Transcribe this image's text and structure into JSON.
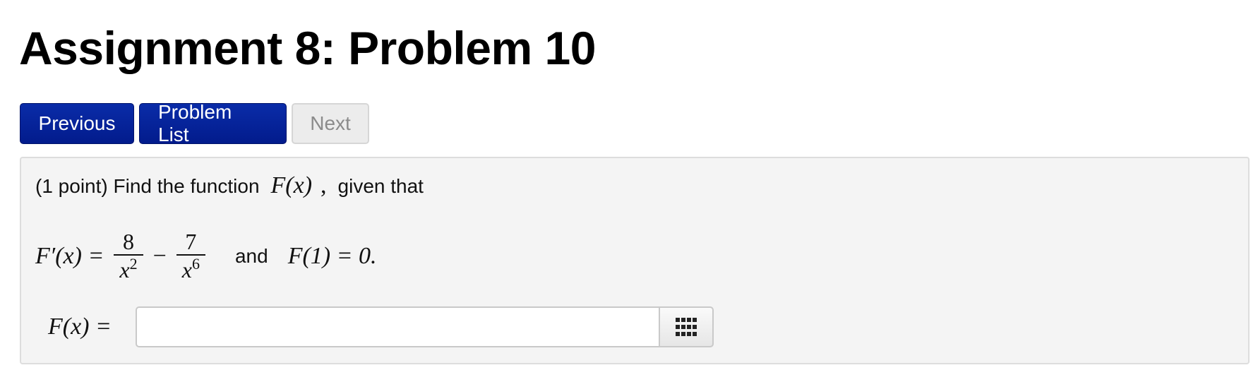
{
  "page": {
    "title": "Assignment 8: Problem 10"
  },
  "nav": {
    "previous_label": "Previous",
    "problem_list_label": "Problem List",
    "next_label": "Next"
  },
  "problem": {
    "points_text": "(1 point) Find the function",
    "function_name": "F(x)",
    "comma": ",",
    "given_text": "given that",
    "derivative_lhs": "F′(x) =",
    "term1_numerator": "8",
    "term1_denominator_base": "x",
    "term1_exponent": "2",
    "minus": "−",
    "term2_numerator": "7",
    "term2_denominator_base": "x",
    "term2_exponent": "6",
    "and_text": "and",
    "initial_condition": "F(1) = 0."
  },
  "answer": {
    "label": "F(x) =",
    "value": "",
    "placeholder": "",
    "palette_icon": "grid-icon"
  },
  "colors": {
    "primary_button": "#021b8c",
    "disabled_button": "#ececec",
    "problem_background": "#f4f4f4"
  }
}
